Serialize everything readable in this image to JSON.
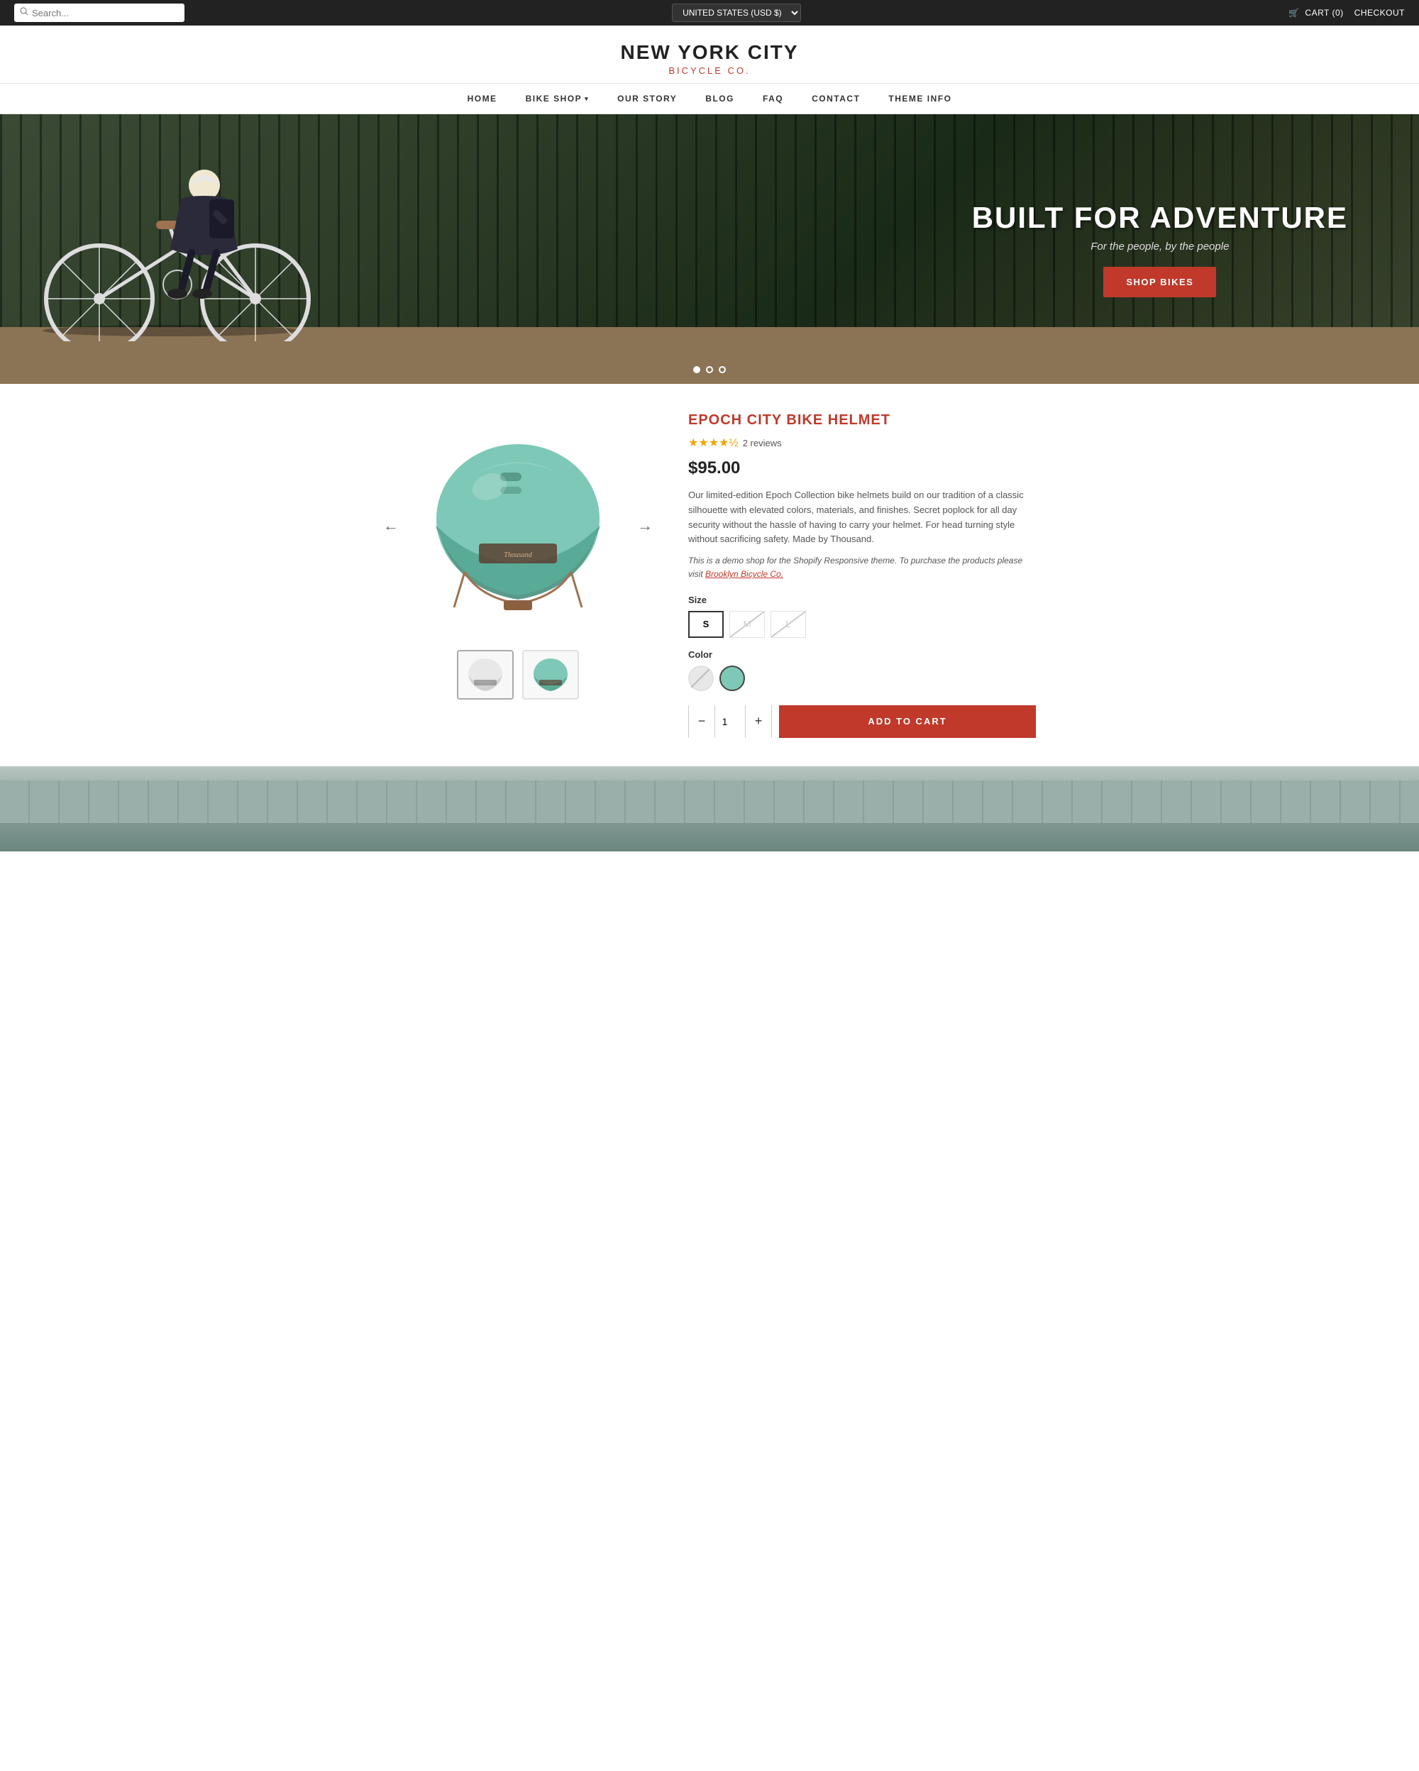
{
  "topbar": {
    "search_placeholder": "Search...",
    "currency": "UNITED STATES (USD $)",
    "cart_label": "CART (0)",
    "checkout_label": "CHECKOUT"
  },
  "header": {
    "brand_line1": "NEW YORK CITY",
    "brand_line2": "BICYCLE CO.",
    "tagline": "BICYCLE CO."
  },
  "nav": {
    "items": [
      {
        "label": "HOME",
        "has_dropdown": false
      },
      {
        "label": "BIKE SHOP",
        "has_dropdown": true
      },
      {
        "label": "OUR STORY",
        "has_dropdown": false
      },
      {
        "label": "BLOG",
        "has_dropdown": false
      },
      {
        "label": "FAQ",
        "has_dropdown": false
      },
      {
        "label": "CONTACT",
        "has_dropdown": false
      },
      {
        "label": "THEME INFO",
        "has_dropdown": false
      }
    ]
  },
  "hero": {
    "title": "BUILT FOR ADVENTURE",
    "subtitle": "For the people, by the people",
    "cta_button": "SHOP BIKES",
    "dots": [
      1,
      2,
      3
    ],
    "active_dot": 1
  },
  "product": {
    "title": "EPOCH CITY BIKE HELMET",
    "rating": "★★★★½",
    "reviews": "2 reviews",
    "price": "$95.00",
    "description": "Our limited-edition Epoch Collection bike helmets build on our tradition of a classic silhouette with elevated colors, materials, and finishes. Secret poplock for all day security without the hassle of having to carry your helmet. For head turning style without sacrificing safety. Made by Thousand.",
    "demo_note_prefix": "This is a demo shop for the Shopify Responsive theme. To purchase the products please visit ",
    "demo_link_text": "Brooklyn Bicycle Co.",
    "demo_link_url": "#",
    "size_label": "Size",
    "sizes": [
      {
        "label": "S",
        "available": true,
        "selected": true
      },
      {
        "label": "M",
        "available": false,
        "selected": false
      },
      {
        "label": "L",
        "available": false,
        "selected": false
      }
    ],
    "color_label": "Color",
    "colors": [
      {
        "name": "white",
        "hex": "#e8e8e8",
        "available": false,
        "selected": false
      },
      {
        "name": "mint",
        "hex": "#7ec8b8",
        "available": true,
        "selected": true
      }
    ],
    "quantity": 1,
    "qty_minus": "−",
    "qty_plus": "+",
    "add_to_cart": "ADD TO CART"
  },
  "icons": {
    "search": "🔍",
    "cart": "🛒",
    "arrow_left": "←",
    "arrow_right": "→",
    "chevron_down": "▾"
  }
}
